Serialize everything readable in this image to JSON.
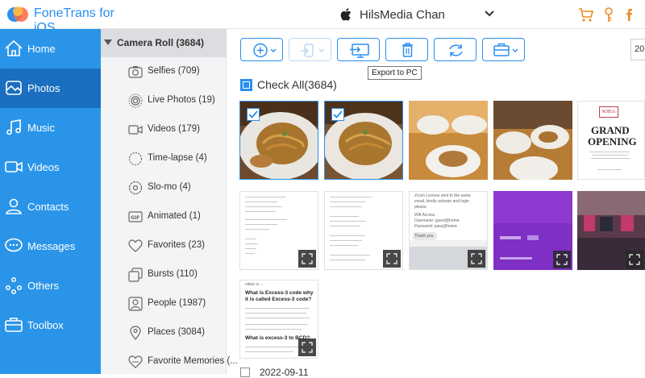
{
  "app": {
    "name": "FoneTrans for iOS"
  },
  "device": {
    "name": "HilsMedia Chan"
  },
  "nav": [
    {
      "label": "Home",
      "icon": "home-icon"
    },
    {
      "label": "Photos",
      "icon": "photos-icon",
      "active": true
    },
    {
      "label": "Music",
      "icon": "music-icon"
    },
    {
      "label": "Videos",
      "icon": "videos-icon"
    },
    {
      "label": "Contacts",
      "icon": "contacts-icon"
    },
    {
      "label": "Messages",
      "icon": "messages-icon"
    },
    {
      "label": "Others",
      "icon": "others-icon"
    },
    {
      "label": "Toolbox",
      "icon": "toolbox-icon"
    }
  ],
  "album": {
    "header": "Camera Roll (3684)"
  },
  "categories": [
    {
      "label": "Selfies (709)",
      "icon": "selfies-icon"
    },
    {
      "label": "Live Photos (19)",
      "icon": "live-photos-icon"
    },
    {
      "label": "Videos (179)",
      "icon": "videos-icon"
    },
    {
      "label": "Time-lapse (4)",
      "icon": "time-lapse-icon"
    },
    {
      "label": "Slo-mo (4)",
      "icon": "slo-mo-icon"
    },
    {
      "label": "Animated (1)",
      "icon": "animated-icon"
    },
    {
      "label": "Favorites (23)",
      "icon": "heart-icon"
    },
    {
      "label": "Bursts (110)",
      "icon": "bursts-icon"
    },
    {
      "label": "People (1987)",
      "icon": "people-icon"
    },
    {
      "label": "Places (3084)",
      "icon": "places-icon"
    },
    {
      "label": "Favorite Memories (...",
      "icon": "memories-icon"
    }
  ],
  "toolbar": {
    "tooltip": "Export to PC",
    "page_value": "20"
  },
  "check_all": {
    "label": "Check All(3684)",
    "checked": true
  },
  "grid": {
    "flyer": {
      "brand": "NOBLE",
      "line1": "GRAND",
      "line2": "OPENING"
    },
    "chat": {
      "line1": "Zoom License sent to the same",
      "line2": "email, kindly activate and login",
      "line3": "please.",
      "line4": "Wifi Access",
      "line5": "Username: guest@home",
      "line6": "Password: pass@home",
      "button": "Thank you"
    },
    "excess": {
      "top": "value is ...",
      "heading1": "What is Excess-3 code why it is called Excess-3 code?",
      "heading2": "What is excess-3 to BCD?"
    }
  },
  "date_row": {
    "label": "2022-09-11"
  },
  "colors": {
    "accent": "#2a8ff0",
    "nav_bg": "#2a95e8",
    "nav_active": "#1a6fc0"
  }
}
